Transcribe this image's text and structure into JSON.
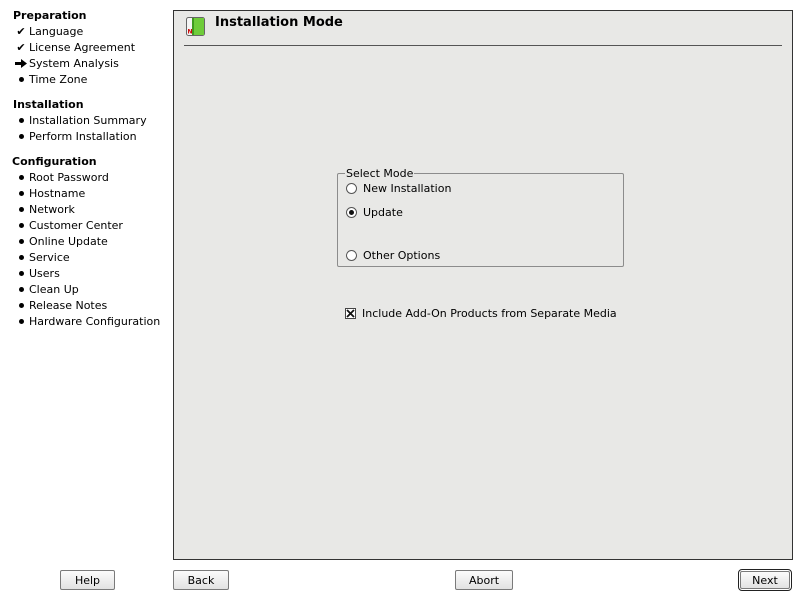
{
  "sidebar": {
    "sections": [
      {
        "title": "Preparation",
        "steps": [
          {
            "label": "Language",
            "state": "done"
          },
          {
            "label": "License Agreement",
            "state": "done"
          },
          {
            "label": "System Analysis",
            "state": "current"
          },
          {
            "label": "Time Zone",
            "state": "pending"
          }
        ]
      },
      {
        "title": "Installation",
        "steps": [
          {
            "label": "Installation Summary",
            "state": "pending"
          },
          {
            "label": "Perform Installation",
            "state": "pending"
          }
        ]
      },
      {
        "title": "Configuration",
        "steps": [
          {
            "label": "Root Password",
            "state": "pending"
          },
          {
            "label": "Hostname",
            "state": "pending"
          },
          {
            "label": "Network",
            "state": "pending"
          },
          {
            "label": "Customer Center",
            "state": "pending"
          },
          {
            "label": "Online Update",
            "state": "pending"
          },
          {
            "label": "Service",
            "state": "pending"
          },
          {
            "label": "Users",
            "state": "pending"
          },
          {
            "label": "Clean Up",
            "state": "pending"
          },
          {
            "label": "Release Notes",
            "state": "pending"
          },
          {
            "label": "Hardware Configuration",
            "state": "pending"
          }
        ]
      }
    ]
  },
  "main": {
    "title": "Installation Mode",
    "select_mode": {
      "title": "Select Mode",
      "options": [
        {
          "label": "New Installation",
          "selected": false
        },
        {
          "label": "Update",
          "selected": true
        },
        {
          "label": "Other Options",
          "selected": false
        }
      ]
    },
    "addon_checkbox": {
      "label": "Include Add-On Products from Separate Media",
      "checked": true
    }
  },
  "buttons": {
    "help": "Help",
    "back": "Back",
    "abort": "Abort",
    "next": "Next"
  }
}
